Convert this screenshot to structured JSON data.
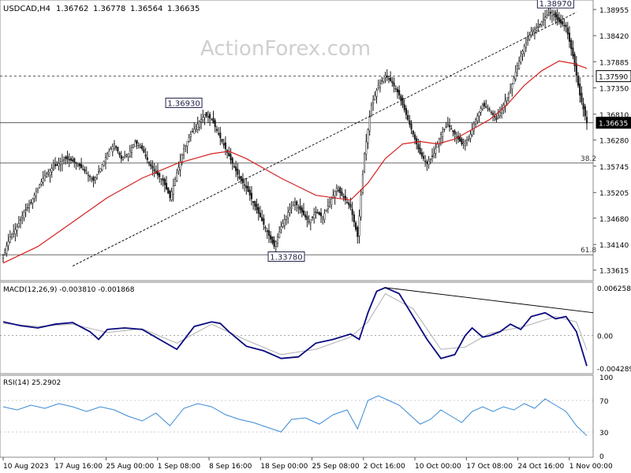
{
  "header": {
    "symbol": "USDCAD,H4",
    "open": "1.36762",
    "high": "1.36778",
    "low": "1.36564",
    "close": "1.36635"
  },
  "watermark": "ActionForex.com",
  "colors": {
    "bull_candle": "#1a1a1a",
    "moving_average": "#d62020",
    "macd_line": "#0a0a80",
    "signal_line": "#b0b0b0",
    "rsi_line": "#3a8ad6",
    "trendline": "#000000"
  },
  "chart_data": [
    {
      "panel": "price",
      "type": "candlestick",
      "title": "USDCAD,H4",
      "ohlc_last": {
        "open": 1.36762,
        "high": 1.36778,
        "low": 1.36564,
        "close": 1.36635
      },
      "y_ticks": [
        "1.38955",
        "1.38420",
        "1.37885",
        "1.37350",
        "1.36810",
        "1.36280",
        "1.35745",
        "1.35205",
        "1.34680",
        "1.34140",
        "1.33615"
      ],
      "ylim": [
        1.334,
        1.3915
      ],
      "x_ticks": [
        "10 Aug 2023",
        "17 Aug 16:00",
        "25 Aug 00:00",
        "1 Sep 08:00",
        "8 Sep 16:00",
        "18 Sep 00:00",
        "25 Sep 08:00",
        "2 Oct 16:00",
        "10 Oct 00:00",
        "17 Oct 08:00",
        "24 Oct 16:00",
        "1 Nov 00:00"
      ],
      "close_path": [
        [
          0,
          1.3392
        ],
        [
          4,
          1.343
        ],
        [
          8,
          1.345
        ],
        [
          12,
          1.348
        ],
        [
          16,
          1.35
        ],
        [
          20,
          1.353
        ],
        [
          24,
          1.3555
        ],
        [
          28,
          1.357
        ],
        [
          32,
          1.358
        ],
        [
          36,
          1.359
        ],
        [
          40,
          1.3585
        ],
        [
          44,
          1.3575
        ],
        [
          48,
          1.356
        ],
        [
          52,
          1.3545
        ],
        [
          56,
          1.357
        ],
        [
          60,
          1.36
        ],
        [
          64,
          1.362
        ],
        [
          68,
          1.359
        ],
        [
          72,
          1.36
        ],
        [
          76,
          1.3625
        ],
        [
          80,
          1.361
        ],
        [
          84,
          1.358
        ],
        [
          88,
          1.356
        ],
        [
          92,
          1.3545
        ],
        [
          96,
          1.351
        ],
        [
          100,
          1.356
        ],
        [
          104,
          1.361
        ],
        [
          108,
          1.364
        ],
        [
          112,
          1.366
        ],
        [
          116,
          1.368
        ],
        [
          120,
          1.367
        ],
        [
          124,
          1.364
        ],
        [
          128,
          1.361
        ],
        [
          132,
          1.358
        ],
        [
          136,
          1.355
        ],
        [
          140,
          1.353
        ],
        [
          144,
          1.35
        ],
        [
          148,
          1.347
        ],
        [
          152,
          1.344
        ],
        [
          156,
          1.341
        ],
        [
          160,
          1.345
        ],
        [
          164,
          1.348
        ],
        [
          168,
          1.35
        ],
        [
          172,
          1.348
        ],
        [
          176,
          1.346
        ],
        [
          180,
          1.348
        ],
        [
          184,
          1.347
        ],
        [
          188,
          1.35
        ],
        [
          192,
          1.353
        ],
        [
          196,
          1.351
        ],
        [
          200,
          1.349
        ],
        [
          204,
          1.343
        ],
        [
          208,
          1.36
        ],
        [
          212,
          1.37
        ],
        [
          216,
          1.374
        ],
        [
          220,
          1.376
        ],
        [
          224,
          1.3745
        ],
        [
          228,
          1.372
        ],
        [
          232,
          1.368
        ],
        [
          236,
          1.364
        ],
        [
          240,
          1.36
        ],
        [
          244,
          1.358
        ],
        [
          248,
          1.36
        ],
        [
          252,
          1.364
        ],
        [
          256,
          1.366
        ],
        [
          260,
          1.364
        ],
        [
          264,
          1.362
        ],
        [
          268,
          1.363
        ],
        [
          272,
          1.367
        ],
        [
          276,
          1.37
        ],
        [
          280,
          1.369
        ],
        [
          284,
          1.367
        ],
        [
          288,
          1.37
        ],
        [
          292,
          1.373
        ],
        [
          296,
          1.378
        ],
        [
          300,
          1.382
        ],
        [
          304,
          1.385
        ],
        [
          308,
          1.386
        ],
        [
          312,
          1.388
        ],
        [
          316,
          1.389
        ],
        [
          320,
          1.387
        ],
        [
          324,
          1.386
        ],
        [
          328,
          1.38
        ],
        [
          332,
          1.372
        ],
        [
          336,
          1.3663
        ]
      ],
      "ma_path": [
        [
          0,
          1.3376
        ],
        [
          20,
          1.341
        ],
        [
          40,
          1.346
        ],
        [
          60,
          1.351
        ],
        [
          80,
          1.355
        ],
        [
          100,
          1.358
        ],
        [
          120,
          1.36
        ],
        [
          130,
          1.3605
        ],
        [
          140,
          1.359
        ],
        [
          160,
          1.355
        ],
        [
          180,
          1.3515
        ],
        [
          200,
          1.3505
        ],
        [
          210,
          1.354
        ],
        [
          220,
          1.359
        ],
        [
          230,
          1.362
        ],
        [
          240,
          1.3625
        ],
        [
          250,
          1.362
        ],
        [
          260,
          1.363
        ],
        [
          270,
          1.365
        ],
        [
          280,
          1.367
        ],
        [
          290,
          1.37
        ],
        [
          300,
          1.374
        ],
        [
          310,
          1.377
        ],
        [
          320,
          1.379
        ],
        [
          328,
          1.3785
        ],
        [
          336,
          1.3775
        ]
      ],
      "horizontal_levels": [
        {
          "value": 1.3759,
          "label": "1.37590",
          "style": "dashed"
        },
        {
          "value": 1.36635,
          "label": "1.36635",
          "style": "solid",
          "current": true
        },
        {
          "value": 1.3581,
          "label": "38.2",
          "style": "solid",
          "fib": true
        },
        {
          "value": 1.3393,
          "label": "61.8",
          "style": "solid",
          "fib": true
        }
      ],
      "trendline": {
        "from": [
          40,
          1.337
        ],
        "to": [
          330,
          1.389
        ]
      },
      "annotations": [
        {
          "text": "1.36930",
          "value": 1.3693,
          "at": 104
        },
        {
          "text": "1.33780",
          "value": 1.3378,
          "at": 163
        },
        {
          "text": "1.38970",
          "value": 1.3897,
          "at": 318
        }
      ]
    },
    {
      "panel": "macd",
      "type": "line",
      "title": "MACD(12,26,9) -0.003810 -0.001868",
      "y_ticks": [
        "0.006258",
        "0.00",
        "-0.004289"
      ],
      "ylim": [
        -0.005,
        0.007
      ],
      "series": [
        {
          "name": "MACD",
          "values": [
            [
              0,
              0.0018
            ],
            [
              10,
              0.0013
            ],
            [
              20,
              0.001
            ],
            [
              30,
              0.0015
            ],
            [
              40,
              0.0017
            ],
            [
              50,
              0.0005
            ],
            [
              55,
              -0.0005
            ],
            [
              60,
              0.0008
            ],
            [
              70,
              0.001
            ],
            [
              80,
              0.0008
            ],
            [
              90,
              -0.0005
            ],
            [
              100,
              -0.0018
            ],
            [
              110,
              0.0012
            ],
            [
              120,
              0.0018
            ],
            [
              125,
              0.0016
            ],
            [
              130,
              0.0005
            ],
            [
              140,
              -0.0014
            ],
            [
              150,
              -0.002
            ],
            [
              160,
              -0.003
            ],
            [
              170,
              -0.0028
            ],
            [
              180,
              -0.001
            ],
            [
              190,
              -0.0005
            ],
            [
              200,
              0.0002
            ],
            [
              205,
              -0.0005
            ],
            [
              210,
              0.003
            ],
            [
              215,
              0.0058
            ],
            [
              220,
              0.0063
            ],
            [
              228,
              0.0055
            ],
            [
              236,
              0.0025
            ],
            [
              244,
              -0.0005
            ],
            [
              252,
              -0.003
            ],
            [
              260,
              -0.0025
            ],
            [
              266,
              0.0
            ],
            [
              270,
              0.001
            ],
            [
              276,
              -0.0002
            ],
            [
              280,
              0.0
            ],
            [
              286,
              0.0005
            ],
            [
              292,
              0.0015
            ],
            [
              298,
              0.0008
            ],
            [
              304,
              0.0025
            ],
            [
              312,
              0.003
            ],
            [
              318,
              0.0022
            ],
            [
              324,
              0.0025
            ],
            [
              330,
              0.0005
            ],
            [
              336,
              -0.004
            ]
          ]
        },
        {
          "name": "Signal",
          "values": [
            [
              0,
              0.0016
            ],
            [
              20,
              0.0012
            ],
            [
              40,
              0.0015
            ],
            [
              60,
              0.0004
            ],
            [
              80,
              0.0009
            ],
            [
              100,
              -0.001
            ],
            [
              120,
              0.0015
            ],
            [
              140,
              -0.0006
            ],
            [
              160,
              -0.0025
            ],
            [
              180,
              -0.0018
            ],
            [
              200,
              -0.0002
            ],
            [
              210,
              0.0018
            ],
            [
              220,
              0.0055
            ],
            [
              236,
              0.0035
            ],
            [
              252,
              -0.0018
            ],
            [
              266,
              -0.0015
            ],
            [
              280,
              0.0003
            ],
            [
              300,
              0.0012
            ],
            [
              318,
              0.0025
            ],
            [
              330,
              0.0018
            ],
            [
              336,
              -0.0019
            ]
          ]
        }
      ],
      "trendline": {
        "from": [
          220,
          0.0063
        ],
        "to": [
          336,
          0.003
        ]
      }
    },
    {
      "panel": "rsi",
      "type": "line",
      "title": "RSI(14) 25.2902",
      "y_ticks": [
        "100",
        "70",
        "30",
        "0"
      ],
      "ylim": [
        0,
        100
      ],
      "levels": [
        70,
        30
      ],
      "series": [
        {
          "name": "RSI",
          "values": [
            [
              0,
              62
            ],
            [
              8,
              58
            ],
            [
              16,
              64
            ],
            [
              24,
              60
            ],
            [
              32,
              66
            ],
            [
              40,
              62
            ],
            [
              48,
              56
            ],
            [
              56,
              62
            ],
            [
              64,
              58
            ],
            [
              72,
              50
            ],
            [
              80,
              44
            ],
            [
              88,
              54
            ],
            [
              96,
              38
            ],
            [
              104,
              60
            ],
            [
              112,
              66
            ],
            [
              120,
              62
            ],
            [
              128,
              52
            ],
            [
              136,
              46
            ],
            [
              144,
              42
            ],
            [
              152,
              36
            ],
            [
              160,
              30
            ],
            [
              166,
              46
            ],
            [
              174,
              48
            ],
            [
              182,
              40
            ],
            [
              190,
              52
            ],
            [
              198,
              58
            ],
            [
              204,
              34
            ],
            [
              210,
              70
            ],
            [
              216,
              76
            ],
            [
              222,
              70
            ],
            [
              228,
              64
            ],
            [
              234,
              52
            ],
            [
              240,
              40
            ],
            [
              246,
              46
            ],
            [
              252,
              58
            ],
            [
              258,
              50
            ],
            [
              264,
              42
            ],
            [
              270,
              56
            ],
            [
              276,
              62
            ],
            [
              282,
              56
            ],
            [
              288,
              62
            ],
            [
              294,
              58
            ],
            [
              300,
              66
            ],
            [
              306,
              60
            ],
            [
              312,
              72
            ],
            [
              318,
              64
            ],
            [
              324,
              56
            ],
            [
              330,
              38
            ],
            [
              336,
              25.3
            ]
          ]
        }
      ]
    }
  ]
}
